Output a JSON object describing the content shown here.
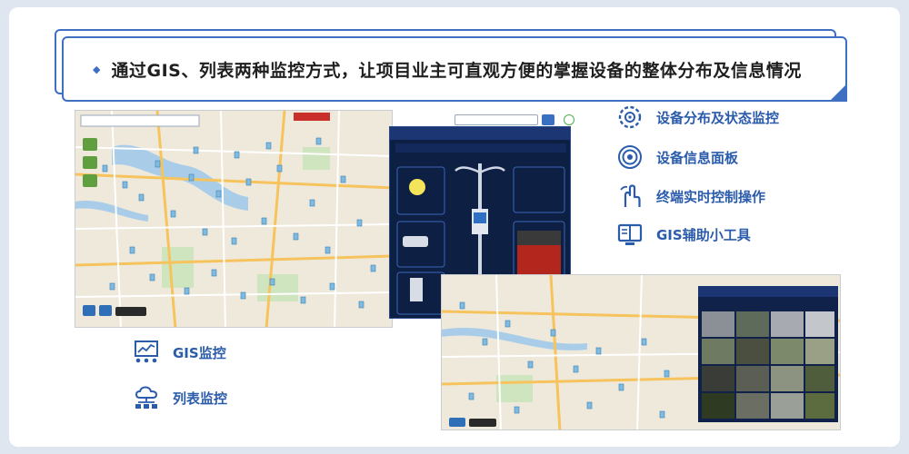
{
  "banner": {
    "text": "通过GIS、列表两种监控方式，让项目业主可直观方便的掌握设备的整体分布及信息情况"
  },
  "features": [
    {
      "label": "设备分布及状态监控",
      "icon": "gear-grid-icon"
    },
    {
      "label": "设备信息面板",
      "icon": "target-panel-icon"
    },
    {
      "label": "终端实时控制操作",
      "icon": "hand-touch-icon"
    },
    {
      "label": "GIS辅助小工具",
      "icon": "book-tools-icon"
    }
  ],
  "bottom_features": [
    {
      "label": "GIS监控",
      "icon": "chart-nodes-icon"
    },
    {
      "label": "列表监控",
      "icon": "cloud-network-icon"
    }
  ],
  "colors": {
    "accent": "#3d6fc2",
    "label": "#2b5cab",
    "panel_bg": "#0e1f44",
    "map_bg": "#efe9dc"
  }
}
